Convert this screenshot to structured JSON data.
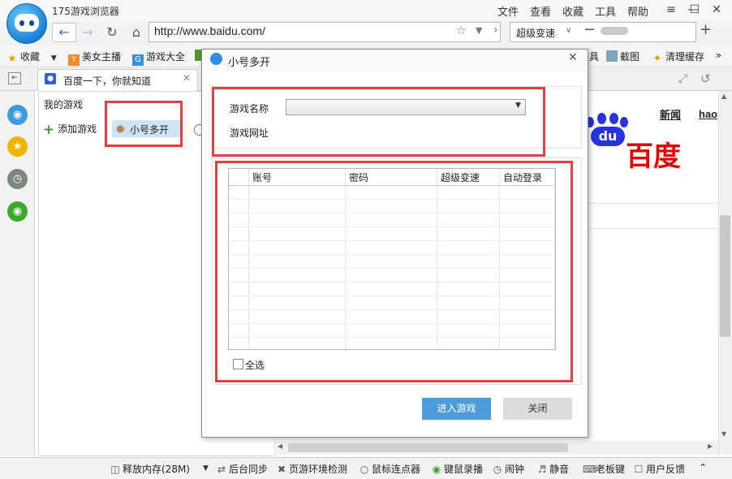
{
  "app": {
    "title": "175游戏浏览器"
  },
  "menu": [
    "文件",
    "查看",
    "收藏",
    "工具",
    "帮助"
  ],
  "window_controls": {
    "skin": "≡",
    "minimize": "—",
    "maximize": "☐",
    "close": "✕"
  },
  "address": {
    "url": "http://www.baidu.com/",
    "speed_label": "超级变速"
  },
  "bookmarks": {
    "favorites_label": "收藏",
    "items": [
      {
        "label": "美女主播",
        "icon_color": "#f08a24"
      },
      {
        "label": "游戏大全",
        "icon_color": "#3b8fe0"
      },
      {
        "label": "具",
        "icon_color": "#4a9a2a"
      },
      {
        "label": "截图",
        "icon_color": "#6aa"
      },
      {
        "label": "清理缓存",
        "icon_color": "#e6b800"
      }
    ]
  },
  "tab": {
    "title": "百度一下，你就知道"
  },
  "game_panel": {
    "my_games": "我的游戏",
    "add_game": "添加游戏",
    "multi_open": "小号多开"
  },
  "webpage": {
    "news_link": "新闻",
    "hao_link": "hao",
    "brand": "百度"
  },
  "dialog": {
    "title": "小号多开",
    "game_name_label": "游戏名称",
    "game_url_label": "游戏网址",
    "columns": [
      "账号",
      "密码",
      "超级变速",
      "自动登录"
    ],
    "select_all": "全选",
    "enter_button": "进入游戏",
    "close_button": "关闭",
    "accent_color": "#4e9bdb"
  },
  "status_bar": [
    {
      "label": "释放内存(28M)",
      "icon": "trash-icon"
    },
    {
      "label": "后台同步",
      "icon": "sync-icon"
    },
    {
      "label": "页游环境检测",
      "icon": "tools-icon"
    },
    {
      "label": "鼠标连点器",
      "icon": "mouse-icon"
    },
    {
      "label": "键鼠录播",
      "icon": "record-icon"
    },
    {
      "label": "闹钟",
      "icon": "alarm-icon"
    },
    {
      "label": "静音",
      "icon": "speaker-icon"
    },
    {
      "label": "老板键",
      "icon": "boss-key-icon"
    },
    {
      "label": "用户反馈",
      "icon": "feedback-icon"
    }
  ]
}
